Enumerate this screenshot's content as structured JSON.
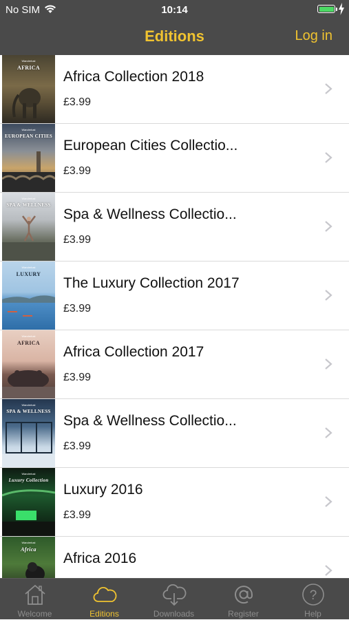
{
  "status": {
    "carrier": "No SIM",
    "time": "10:14",
    "battery_level": 1.0
  },
  "nav": {
    "title": "Editions",
    "login_label": "Log in"
  },
  "editions": [
    {
      "name": "Africa Collection 2018",
      "price": "£3.99",
      "cover_text": "AFRICA"
    },
    {
      "name": "European Cities Collectio...",
      "price": "£3.99",
      "cover_text": "EUROPEAN CITIES"
    },
    {
      "name": "Spa & Wellness Collectio...",
      "price": "£3.99",
      "cover_text": "SPA & WELLNESS"
    },
    {
      "name": "The Luxury Collection 2017",
      "price": "£3.99",
      "cover_text": "LUXURY"
    },
    {
      "name": "Africa Collection 2017",
      "price": "£3.99",
      "cover_text": "AFRICA"
    },
    {
      "name": "Spa & Wellness Collectio...",
      "price": "£3.99",
      "cover_text": "SPA & WELLNESS"
    },
    {
      "name": "Luxury 2016",
      "price": "£3.99",
      "cover_text": "Luxury Collection"
    },
    {
      "name": "Africa 2016",
      "price": "",
      "cover_text": "Africa"
    }
  ],
  "tabs": [
    {
      "label": "Welcome",
      "icon": "house-icon",
      "active": false
    },
    {
      "label": "Editions",
      "icon": "cloud-icon",
      "active": true
    },
    {
      "label": "Downloads",
      "icon": "cloud-download-icon",
      "active": false
    },
    {
      "label": "Register",
      "icon": "at-sign-icon",
      "active": false
    },
    {
      "label": "Help",
      "icon": "help-circle-icon",
      "active": false
    }
  ],
  "colors": {
    "accent": "#f0c330",
    "bar_background": "#4a4a4a",
    "tab_inactive": "#8e8e8e"
  }
}
